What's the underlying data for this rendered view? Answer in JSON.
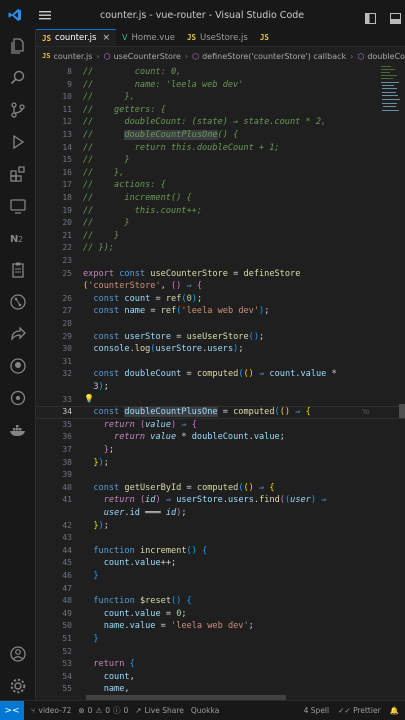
{
  "window": {
    "title": "counter.js - vue-router - Visual Studio Code"
  },
  "tabs": [
    {
      "badge": "JS",
      "label": "counter.js",
      "active": true,
      "close": "×"
    },
    {
      "badge": "V",
      "label": "Home.vue",
      "active": false
    },
    {
      "badge": "JS",
      "label": "UseStore.js",
      "active": false
    },
    {
      "badge": "JS",
      "label": "",
      "active": false
    }
  ],
  "breadcrumbs": {
    "file_badge": "JS",
    "file": "counter.js",
    "items": [
      "useCounterStore",
      "defineStore('counterStore') callback",
      "doubleCount"
    ]
  },
  "editor": {
    "lines": [
      {
        "n": "8",
        "html": "<span class=\"cm\">//        count: 0,</span>"
      },
      {
        "n": "9",
        "html": "<span class=\"cm\">//        name: 'leela web dev'</span>"
      },
      {
        "n": "10",
        "html": "<span class=\"cm\">//      },</span>"
      },
      {
        "n": "11",
        "html": "<span class=\"cm\">//    getters: {</span>"
      },
      {
        "n": "12",
        "html": "<span class=\"cm\">//      doubleCount: (state) ⇒ state.count * 2,</span>"
      },
      {
        "n": "13",
        "html": "<span class=\"cm\">//      <span class=\"hl\">doubleCountPlusOne</span>() {</span>"
      },
      {
        "n": "14",
        "html": "<span class=\"cm\">//        return this.doubleCount + 1;</span>"
      },
      {
        "n": "15",
        "html": "<span class=\"cm\">//      }</span>"
      },
      {
        "n": "16",
        "html": "<span class=\"cm\">//    },</span>"
      },
      {
        "n": "17",
        "html": "<span class=\"cm\">//    actions: {</span>"
      },
      {
        "n": "18",
        "html": "<span class=\"cm\">//      increment() {</span>"
      },
      {
        "n": "19",
        "html": "<span class=\"cm\">//        this.count++;</span>"
      },
      {
        "n": "20",
        "html": "<span class=\"cm\">//      }</span>"
      },
      {
        "n": "21",
        "html": "<span class=\"cm\">//    }</span>"
      },
      {
        "n": "22",
        "html": "<span class=\"cm\">// });</span>"
      },
      {
        "n": "23",
        "html": ""
      },
      {
        "n": "25",
        "html": "<span class=\"kw2\">export</span> <span class=\"kw\">const</span> <span class=\"fn\">useCounterStore</span> <span class=\"pl\">=</span> <span class=\"fn\">defineStore</span>"
      },
      {
        "n": "",
        "html": "<span class=\"br1\">(</span><span class=\"str\">'counterStore'</span><span class=\"pl\">,</span> <span class=\"br2\">()</span> <span class=\"kw\">⇒</span> <span class=\"br2\">{</span>"
      },
      {
        "n": "26",
        "html": "  <span class=\"kw\">const</span> <span class=\"var\">count</span> <span class=\"pl\">=</span> <span class=\"fn\">ref</span><span class=\"br3\">(</span><span class=\"num\">0</span><span class=\"br3\">)</span><span class=\"pl\">;</span>"
      },
      {
        "n": "27",
        "html": "  <span class=\"kw\">const</span> <span class=\"var\">name</span> <span class=\"pl\">=</span> <span class=\"fn\">ref</span><span class=\"br3\">(</span><span class=\"str\">'leela web dev'</span><span class=\"br3\">)</span><span class=\"pl\">;</span>"
      },
      {
        "n": "28",
        "html": ""
      },
      {
        "n": "29",
        "html": "  <span class=\"kw\">const</span> <span class=\"var\">userStore</span> <span class=\"pl\">=</span> <span class=\"fn\">useUserStore</span><span class=\"br3\">()</span><span class=\"pl\">;</span>"
      },
      {
        "n": "30",
        "html": "  <span class=\"var\">console</span><span class=\"pl\">.</span><span class=\"fn\">log</span><span class=\"br3\">(</span><span class=\"var\">userStore</span><span class=\"pl\">.</span><span class=\"var\">users</span><span class=\"br3\">)</span><span class=\"pl\">;</span>"
      },
      {
        "n": "31",
        "html": ""
      },
      {
        "n": "32",
        "html": "  <span class=\"kw\">const</span> <span class=\"var\">doubleCount</span> <span class=\"pl\">=</span> <span class=\"fn\">computed</span><span class=\"br3\">(</span><span class=\"br1\">()</span> <span class=\"kw\">⇒</span> <span class=\"var\">count</span><span class=\"pl\">.</span><span class=\"var\">value</span> <span class=\"pl\">*</span>"
      },
      {
        "n": "",
        "html": "  <span class=\"num\">3</span><span class=\"br3\">)</span><span class=\"pl\">;</span>"
      },
      {
        "n": "33",
        "html": ""
      },
      {
        "n": "34",
        "html": "  <span class=\"kw\">const</span> <span class=\"var hl\">doubleCountPlusOne</span> <span class=\"pl\">=</span> <span class=\"fn\">computed</span><span class=\"br3\">(</span><span class=\"br1\">()</span> <span class=\"kw\">⇒</span> <span class=\"br1\">{</span>",
        "cur": true
      },
      {
        "n": "35",
        "html": "    <span class=\"kw2 it\">return</span> <span class=\"br2\">(</span><span class=\"var it\">value</span><span class=\"br2\">)</span> <span class=\"kw\">⇒</span> <span class=\"br2\">{</span>"
      },
      {
        "n": "36",
        "html": "      <span class=\"kw2 it\">return</span> <span class=\"var it\">value</span> <span class=\"pl\">*</span> <span class=\"var\">doubleCount</span><span class=\"pl\">.</span><span class=\"var\">value</span><span class=\"pl\">;</span>"
      },
      {
        "n": "37",
        "html": "    <span class=\"br2\">}</span><span class=\"pl\">;</span>"
      },
      {
        "n": "38",
        "html": "  <span class=\"br1\">}</span><span class=\"br3\">)</span><span class=\"pl\">;</span>"
      },
      {
        "n": "39",
        "html": ""
      },
      {
        "n": "40",
        "html": "  <span class=\"kw\">const</span> <span class=\"fn\">getUserById</span> <span class=\"pl\">=</span> <span class=\"fn\">computed</span><span class=\"br3\">(</span><span class=\"br1\">()</span> <span class=\"kw\">⇒</span> <span class=\"br1\">{</span>"
      },
      {
        "n": "41",
        "html": "    <span class=\"kw2 it\">return</span> <span class=\"br2\">(</span><span class=\"var it\">id</span><span class=\"br2\">)</span> <span class=\"kw\">⇒</span> <span class=\"var\">userStore</span><span class=\"pl\">.</span><span class=\"var\">users</span><span class=\"pl\">.</span><span class=\"fn\">find</span><span class=\"br2\">(</span><span class=\"br3\">(</span><span class=\"var it\">user</span><span class=\"br3\">)</span> <span class=\"kw\">⇒</span>"
      },
      {
        "n": "",
        "html": "    <span class=\"var it\">user</span><span class=\"pl\">.</span><span class=\"var\">id</span> <span class=\"pl\">═══</span> <span class=\"var it\">id</span><span class=\"br2\">)</span><span class=\"pl\">;</span>"
      },
      {
        "n": "42",
        "html": "  <span class=\"br1\">}</span><span class=\"br3\">)</span><span class=\"pl\">;</span>"
      },
      {
        "n": "43",
        "html": ""
      },
      {
        "n": "44",
        "html": "  <span class=\"kw\">function</span> <span class=\"fn\">increment</span><span class=\"br3\">()</span> <span class=\"br3\">{</span>"
      },
      {
        "n": "45",
        "html": "    <span class=\"var\">count</span><span class=\"pl\">.</span><span class=\"var\">value</span><span class=\"pl\">++;</span>"
      },
      {
        "n": "46",
        "html": "  <span class=\"br3\">}</span>"
      },
      {
        "n": "47",
        "html": ""
      },
      {
        "n": "48",
        "html": "  <span class=\"kw\">function</span> <span class=\"fn\">$reset</span><span class=\"br3\">()</span> <span class=\"br3\">{</span>"
      },
      {
        "n": "49",
        "html": "    <span class=\"var\">count</span><span class=\"pl\">.</span><span class=\"var\">value</span> <span class=\"pl\">=</span> <span class=\"num\">0</span><span class=\"pl\">;</span>"
      },
      {
        "n": "50",
        "html": "    <span class=\"var\">name</span><span class=\"pl\">.</span><span class=\"var\">value</span> <span class=\"pl\">=</span> <span class=\"str\">'leela web dev'</span><span class=\"pl\">;</span>"
      },
      {
        "n": "51",
        "html": "  <span class=\"br3\">}</span>"
      },
      {
        "n": "52",
        "html": ""
      },
      {
        "n": "53",
        "html": "  <span class=\"kw2\">return</span> <span class=\"br3\">{</span>"
      },
      {
        "n": "54",
        "html": "    <span class=\"var\">count</span><span class=\"pl\">,</span>"
      },
      {
        "n": "55",
        "html": "    <span class=\"var\">name</span><span class=\"pl\">,</span>"
      }
    ],
    "blame_text": "Yo"
  },
  "statusbar": {
    "remote": "><",
    "branch": "video-72",
    "errors": "0",
    "warnings": "0",
    "infos": "0",
    "live_share": "Live Share",
    "quokka": "Quokka",
    "spell": "4 Spell",
    "prettier": "Prettier"
  },
  "colors": {
    "accent": "#0078d4",
    "background": "#1f1f1f"
  }
}
